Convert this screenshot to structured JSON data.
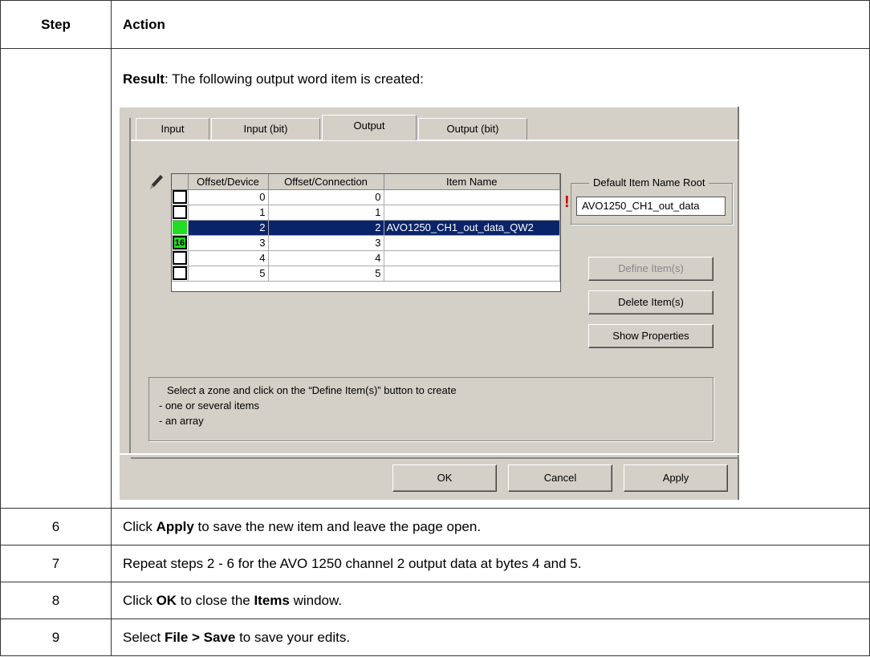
{
  "table": {
    "header_step": "Step",
    "header_action": "Action",
    "result_label": "Result",
    "result_text": ": The following output word item is created:",
    "rows": [
      {
        "step": "6",
        "pre": "Click ",
        "b1": "Apply",
        "mid": " to save the new item and leave the page open.",
        "b2": "",
        "post": ""
      },
      {
        "step": "7",
        "pre": "Repeat steps 2 - 6 for the AVO 1250 channel 2 output data at bytes 4 and 5.",
        "b1": "",
        "mid": "",
        "b2": "",
        "post": ""
      },
      {
        "step": "8",
        "pre": "Click ",
        "b1": "OK",
        "mid": " to close the ",
        "b2": "Items",
        "post": " window."
      },
      {
        "step": "9",
        "pre": "Select ",
        "b1": "File > Save",
        "mid": " to save your edits.",
        "b2": "",
        "post": ""
      }
    ]
  },
  "dialog": {
    "tabs": [
      "Input",
      "Input (bit)",
      "Output",
      "Output (bit)"
    ],
    "active_tab": "Output",
    "pencil_icon": "pencil-icon",
    "columns": [
      "Offset/Device",
      "Offset/Connection",
      "Item Name"
    ],
    "rows": [
      {
        "check": "empty",
        "badge": "",
        "device": "0",
        "connection": "0",
        "name": ""
      },
      {
        "check": "empty",
        "badge": "",
        "device": "1",
        "connection": "1",
        "name": ""
      },
      {
        "check": "green",
        "badge": "",
        "device": "2",
        "connection": "2",
        "name": "AVO1250_CH1_out_data_QW2"
      },
      {
        "check": "green16",
        "badge": "16",
        "device": "3",
        "connection": "3",
        "name": ""
      },
      {
        "check": "empty",
        "badge": "",
        "device": "4",
        "connection": "4",
        "name": ""
      },
      {
        "check": "empty",
        "badge": "",
        "device": "5",
        "connection": "5",
        "name": ""
      }
    ],
    "selected_row": 2,
    "group_title": "Default Item Name Root",
    "name_root_value": "AVO1250_CH1_out_data",
    "warning_glyph": "!",
    "define_button": "Define Item(s)",
    "delete_button": "Delete Item(s)",
    "properties_button": "Show Properties",
    "info_line1": "Select a zone and click on the “Define Item(s)” button to create",
    "info_line2": "- one or several items",
    "info_line3": "- an array",
    "ok_button": "OK",
    "cancel_button": "Cancel",
    "apply_button": "Apply",
    "colors": {
      "selection": "#0a246a",
      "slot": "#22dd22",
      "dialog_bg": "#d4d0c8"
    }
  }
}
